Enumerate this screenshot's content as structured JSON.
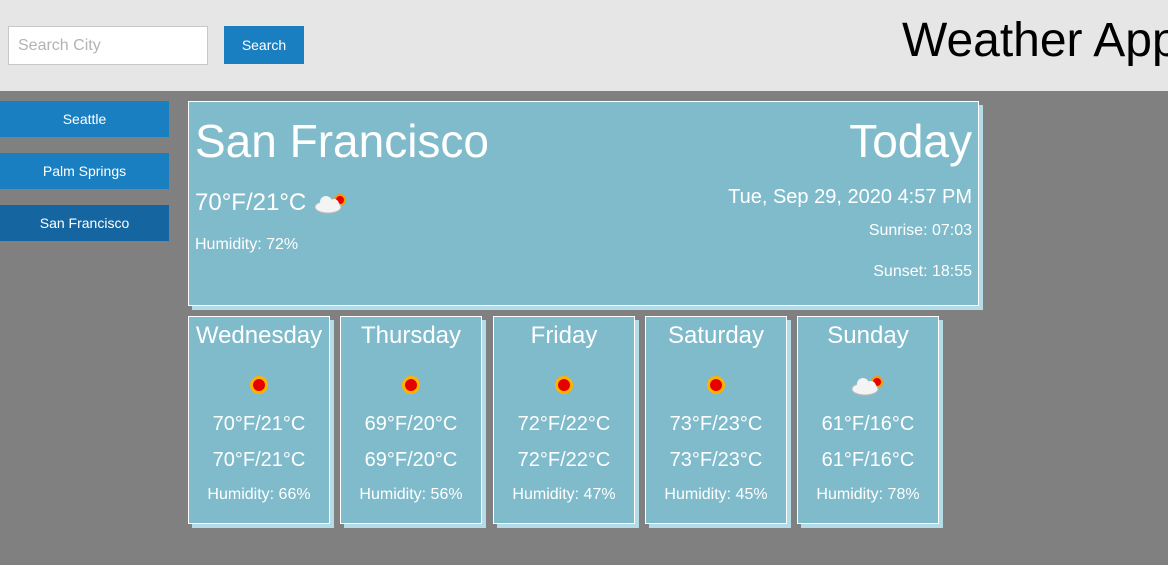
{
  "header": {
    "title": "Weather App",
    "search_placeholder": "Search City",
    "search_value": "",
    "search_button": "Search"
  },
  "sidebar": {
    "items": [
      {
        "label": "Seattle"
      },
      {
        "label": "Palm Springs"
      },
      {
        "label": "San Francisco",
        "active": true
      }
    ]
  },
  "today": {
    "city": "San Francisco",
    "label": "Today",
    "temp": "70°F/21°C",
    "icon": "partly-cloudy-icon",
    "humidity": "Humidity: 72%",
    "date": "Tue, Sep 29, 2020 4:57 PM",
    "sunrise": "Sunrise: 07:03",
    "sunset": "Sunset: 18:55"
  },
  "forecast": [
    {
      "day": "Wednesday",
      "icon": "sun-icon",
      "high": "70°F/21°C",
      "low": "70°F/21°C",
      "humidity": "Humidity: 66%"
    },
    {
      "day": "Thursday",
      "icon": "sun-icon",
      "high": "69°F/20°C",
      "low": "69°F/20°C",
      "humidity": "Humidity: 56%"
    },
    {
      "day": "Friday",
      "icon": "sun-icon",
      "high": "72°F/22°C",
      "low": "72°F/22°C",
      "humidity": "Humidity: 47%"
    },
    {
      "day": "Saturday",
      "icon": "sun-icon",
      "high": "73°F/23°C",
      "low": "73°F/23°C",
      "humidity": "Humidity: 45%"
    },
    {
      "day": "Sunday",
      "icon": "partly-cloudy-icon",
      "high": "61°F/16°C",
      "low": "61°F/16°C",
      "humidity": "Humidity: 78%"
    }
  ],
  "colors": {
    "header_bg": "#e6e6e6",
    "page_bg": "#808080",
    "button_blue": "#1a7fc1",
    "active_blue": "#1565a0",
    "card_bg": "#7fbbcb",
    "card_shadow": "#b5dbe6"
  }
}
